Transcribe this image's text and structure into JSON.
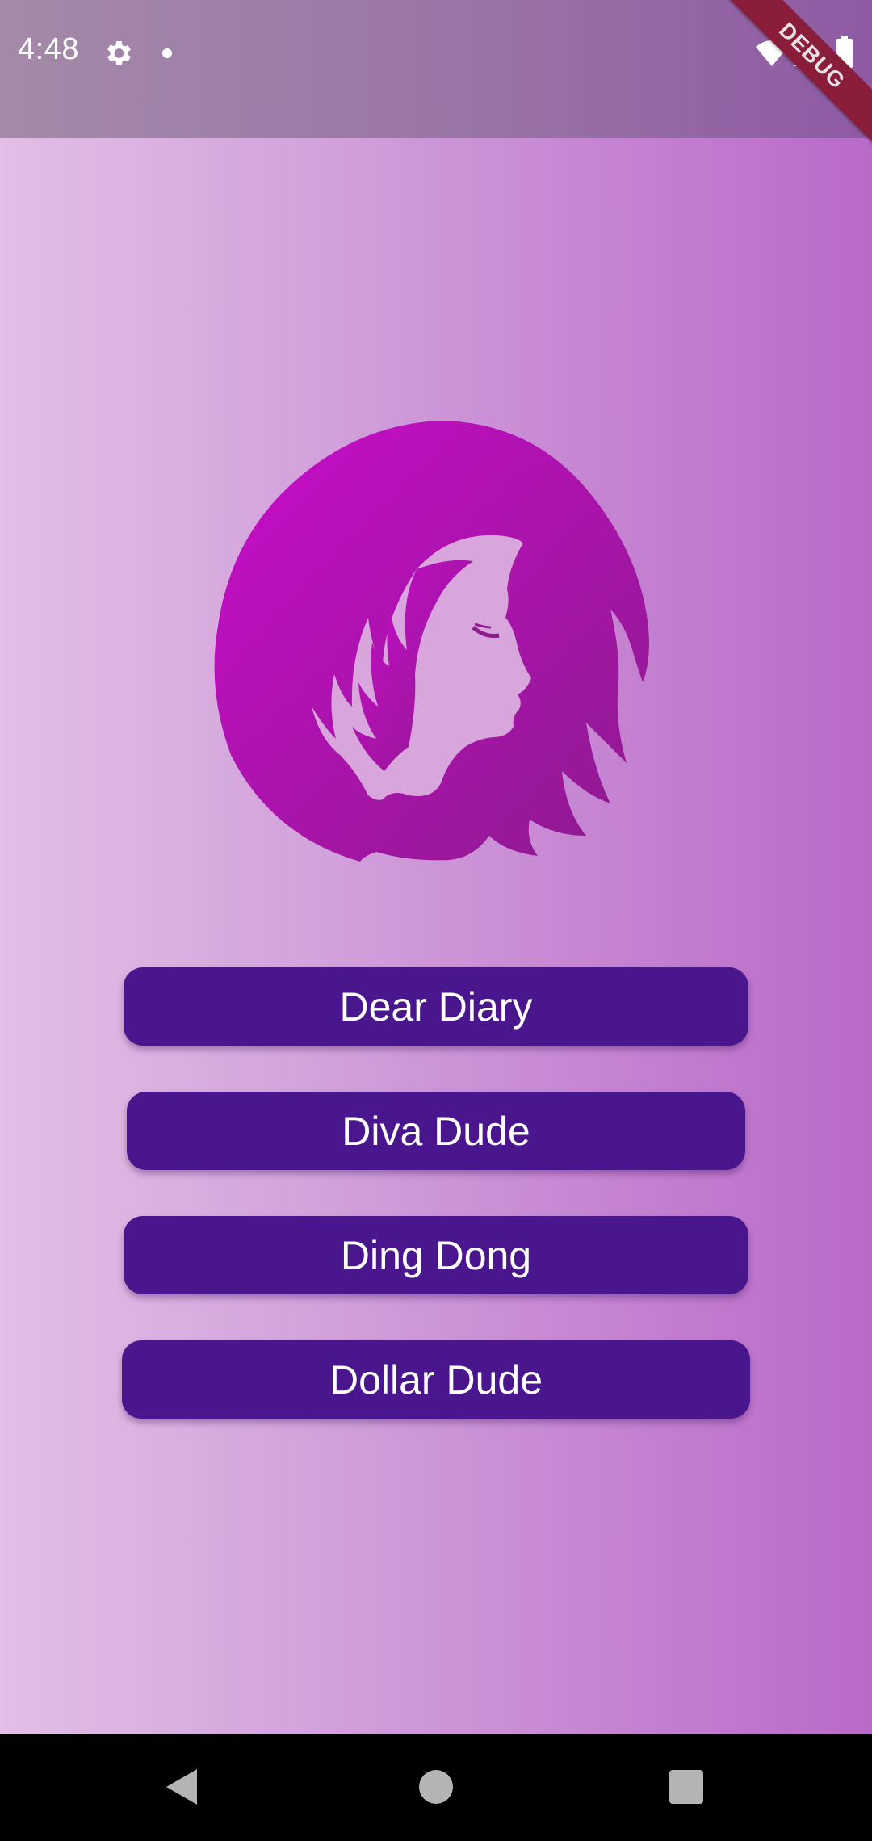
{
  "status_bar": {
    "time": "4:48",
    "icons": [
      "gear-icon",
      "notification-dot-icon",
      "wifi-icon",
      "signal-icon",
      "battery-icon"
    ]
  },
  "debug_banner": {
    "label": "DEBUG",
    "color": "#8a1e3a"
  },
  "logo": {
    "icon": "woman-silhouette-logo-icon",
    "colors": [
      "#c90ccb",
      "#8c1b8d"
    ]
  },
  "menu": {
    "buttons": [
      {
        "label": "Dear Diary"
      },
      {
        "label": "Diva Dude"
      },
      {
        "label": "Ding Dong"
      },
      {
        "label": "Dollar Dude"
      }
    ],
    "button_color": "#4a168e"
  },
  "background": {
    "gradient": [
      "#e2bfe6",
      "#b86ac8"
    ]
  },
  "nav_bar": {
    "icons": [
      "back-icon",
      "home-icon",
      "recents-icon"
    ]
  }
}
